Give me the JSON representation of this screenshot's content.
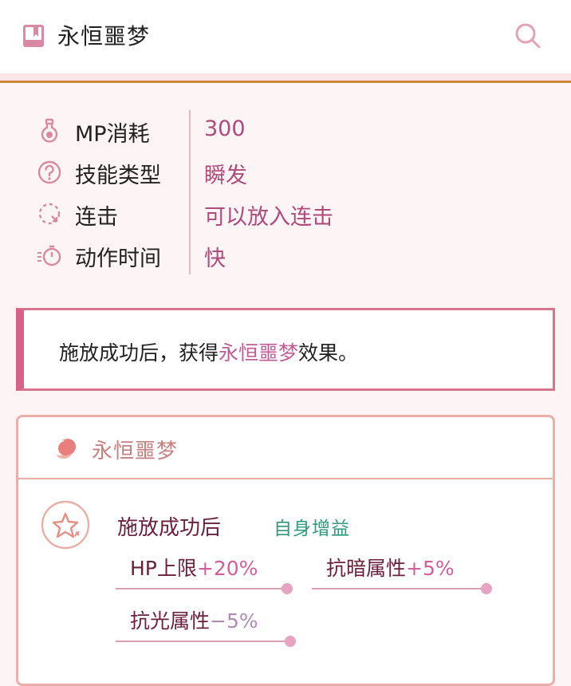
{
  "header": {
    "title": "永恒噩梦",
    "book_icon": "book-icon",
    "search_icon": "search-icon"
  },
  "attributes": [
    {
      "icon": "potion-icon",
      "label": "MP消耗",
      "value": "300"
    },
    {
      "icon": "question-circle-icon",
      "label": "技能类型",
      "value": "瞬发"
    },
    {
      "icon": "dashed-circle-icon",
      "label": "连击",
      "value": "可以放入连击"
    },
    {
      "icon": "stopwatch-icon",
      "label": "动作时间",
      "value": "快"
    }
  ],
  "description": {
    "prefix": "施放成功后，获得",
    "highlight": "永恒噩梦",
    "suffix": "效果。"
  },
  "effect": {
    "icon": "moon-icon",
    "title": "永恒噩梦",
    "trigger_icon": "star-icon",
    "trigger": "施放成功后",
    "tag": "自身增益",
    "stats": [
      {
        "name": "HP上限",
        "value": "+20%"
      },
      {
        "name": "抗暗属性",
        "value": "+5%"
      },
      {
        "name": "抗光属性",
        "value": "−5%"
      }
    ]
  },
  "colors": {
    "accent": "#d9608a",
    "value_text": "#b04a7a",
    "positive": "#d35f9a",
    "tag_green": "#2e9a78",
    "header_rule": "#c8893a"
  }
}
